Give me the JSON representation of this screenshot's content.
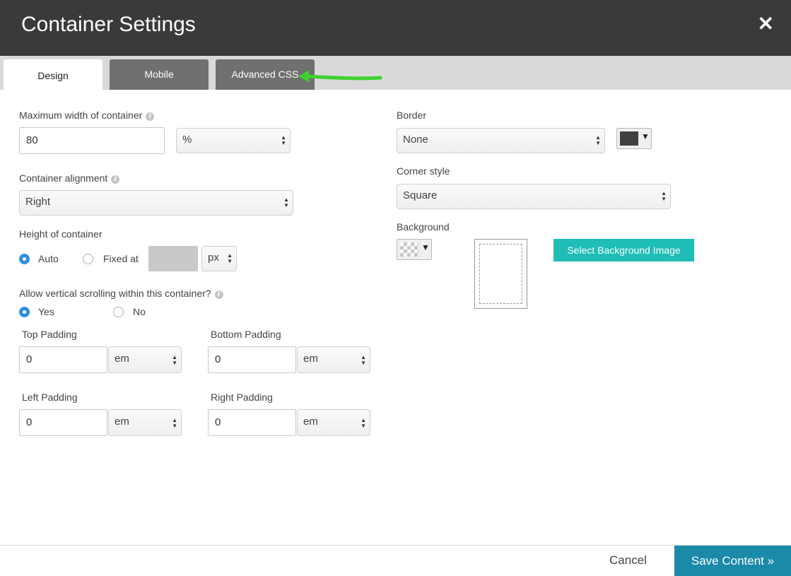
{
  "dialog": {
    "title": "Container Settings",
    "close_glyph": "✕"
  },
  "tabs": [
    {
      "label": "Design",
      "active": true
    },
    {
      "label": "Mobile",
      "active": false
    },
    {
      "label": "Advanced CSS",
      "active": false
    }
  ],
  "annotation": {
    "arrow_color": "#3fd22e",
    "points_to": "Advanced CSS"
  },
  "design": {
    "max_width": {
      "label": "Maximum width of container",
      "value": "80",
      "unit": "%"
    },
    "alignment": {
      "label": "Container alignment",
      "value": "Right"
    },
    "height": {
      "label": "Height of container",
      "auto_label": "Auto",
      "fixed_label": "Fixed at",
      "fixed_value": "",
      "unit": "px",
      "selected": "Auto"
    },
    "scrolling": {
      "label": "Allow vertical scrolling within this container?",
      "yes_label": "Yes",
      "no_label": "No",
      "selected": "Yes"
    },
    "padding": {
      "top": {
        "label": "Top Padding",
        "value": "0",
        "unit": "em"
      },
      "bottom": {
        "label": "Bottom Padding",
        "value": "0",
        "unit": "em"
      },
      "left": {
        "label": "Left Padding",
        "value": "0",
        "unit": "em"
      },
      "right": {
        "label": "Right Padding",
        "value": "0",
        "unit": "em"
      }
    },
    "border": {
      "label": "Border",
      "value": "None",
      "color": "#404040"
    },
    "corner": {
      "label": "Corner style",
      "value": "Square"
    },
    "background": {
      "label": "Background",
      "button_label": "Select Background Image"
    }
  },
  "footer": {
    "cancel_label": "Cancel",
    "save_label": "Save Content »"
  },
  "colors": {
    "titlebar": "#3a3a3a",
    "accent_teal": "#1ebdb5",
    "save_blue": "#1b8aa8",
    "radio_blue": "#2f8fdf"
  }
}
